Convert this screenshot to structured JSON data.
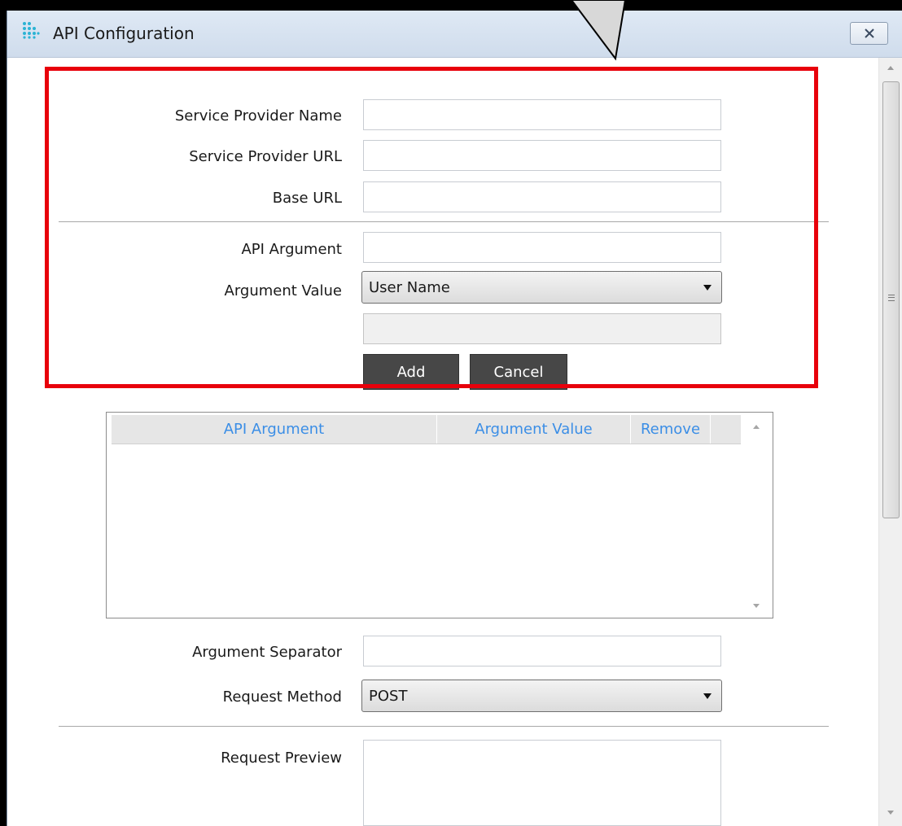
{
  "window": {
    "title": "API Configuration",
    "app_icon": "app-grid-icon",
    "close_icon": "close-icon"
  },
  "form": {
    "service_provider_name": {
      "label": "Service Provider Name",
      "value": ""
    },
    "service_provider_url": {
      "label": "Service Provider URL",
      "value": ""
    },
    "base_url": {
      "label": "Base URL",
      "value": ""
    },
    "api_argument": {
      "label": "API Argument",
      "value": ""
    },
    "argument_value": {
      "label": "Argument Value",
      "selected": "User Name",
      "extra_value": ""
    },
    "add_label": "Add",
    "cancel_label": "Cancel"
  },
  "grid": {
    "columns": [
      "API Argument",
      "Argument Value",
      "Remove"
    ],
    "rows": []
  },
  "lower": {
    "argument_separator": {
      "label": "Argument Separator",
      "value": ""
    },
    "request_method": {
      "label": "Request Method",
      "selected": "POST"
    },
    "request_preview": {
      "label": "Request Preview",
      "value": ""
    }
  },
  "colors": {
    "highlight": "#e8000b",
    "grid_header_text": "#3b8ee6",
    "button_bg": "#474747"
  }
}
